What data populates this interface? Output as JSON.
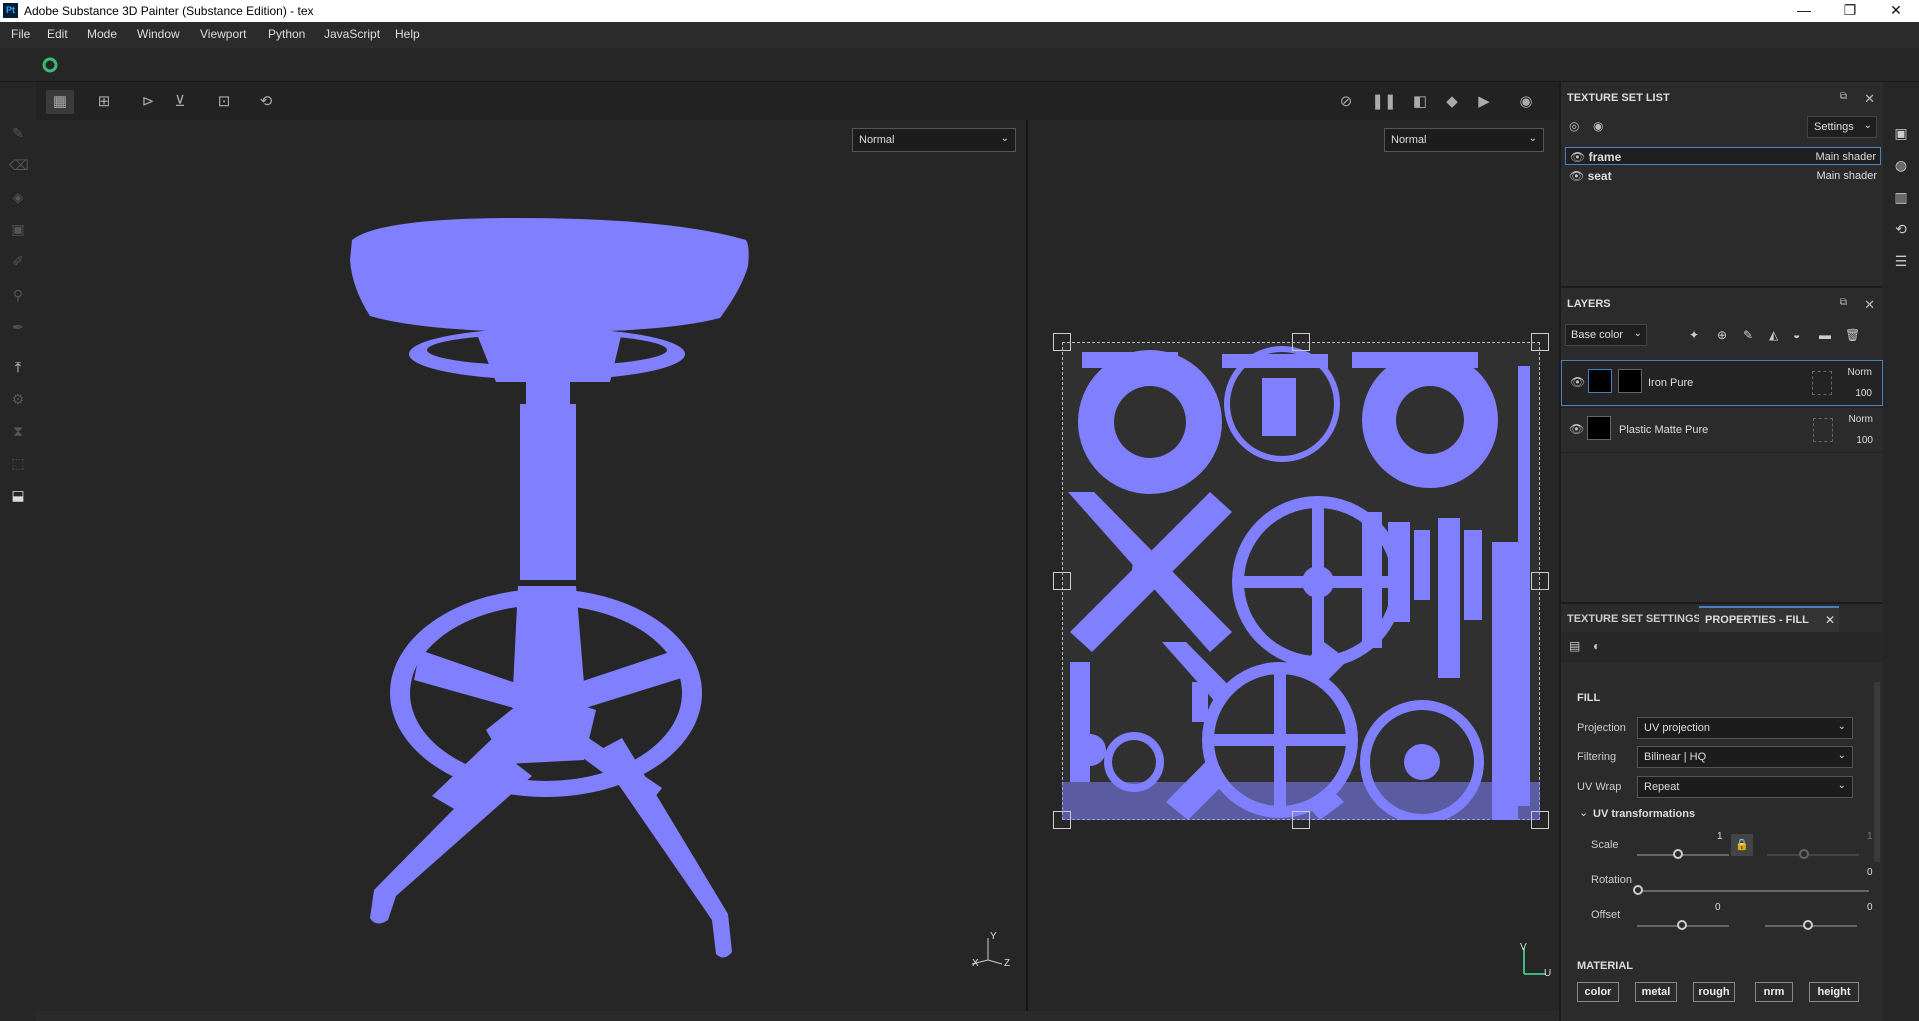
{
  "window": {
    "title": "Adobe Substance 3D Painter (Substance Edition) - tex",
    "logo": "Pt",
    "minimize": "—",
    "restore": "❐",
    "close": "✕"
  },
  "menu": [
    "File",
    "Edit",
    "Mode",
    "Window",
    "Viewport",
    "Python",
    "JavaScript",
    "Help"
  ],
  "viewport": {
    "left_mode": "Normal",
    "right_mode": "Normal",
    "axis_3d": {
      "y": "Y",
      "x": "X",
      "z": "Z"
    },
    "axis_uv": {
      "v": "V",
      "u": "U"
    },
    "uv_color": "#8080ff"
  },
  "texture_set_list": {
    "title": "TEXTURE SET LIST",
    "settings_label": "Settings",
    "items": [
      {
        "name": "frame",
        "shader": "Main shader"
      },
      {
        "name": "seat",
        "shader": "Main shader"
      }
    ]
  },
  "layers": {
    "title": "LAYERS",
    "channel": "Base color",
    "items": [
      {
        "name": "Iron Pure",
        "blend": "Norm",
        "opacity": "100"
      },
      {
        "name": "Plastic Matte Pure",
        "blend": "Norm",
        "opacity": "100"
      }
    ]
  },
  "properties": {
    "tab_texture_set_settings": "TEXTURE SET SETTINGS",
    "tab_properties_fill": "PROPERTIES - FILL",
    "fill_heading": "FILL",
    "projection_label": "Projection",
    "projection_value": "UV projection",
    "filtering_label": "Filtering",
    "filtering_value": "Bilinear | HQ",
    "uvwrap_label": "UV Wrap",
    "uvwrap_value": "Repeat",
    "uv_transformations": "UV transformations",
    "scale_label": "Scale",
    "scale_value": "1",
    "scale_value2": "1",
    "rotation_label": "Rotation",
    "rotation_value": "0",
    "offset_label": "Offset",
    "offset_value_x": "0",
    "offset_value_y": "0",
    "material_heading": "MATERIAL",
    "material_buttons": [
      "color",
      "metal",
      "rough",
      "nrm",
      "height"
    ]
  }
}
